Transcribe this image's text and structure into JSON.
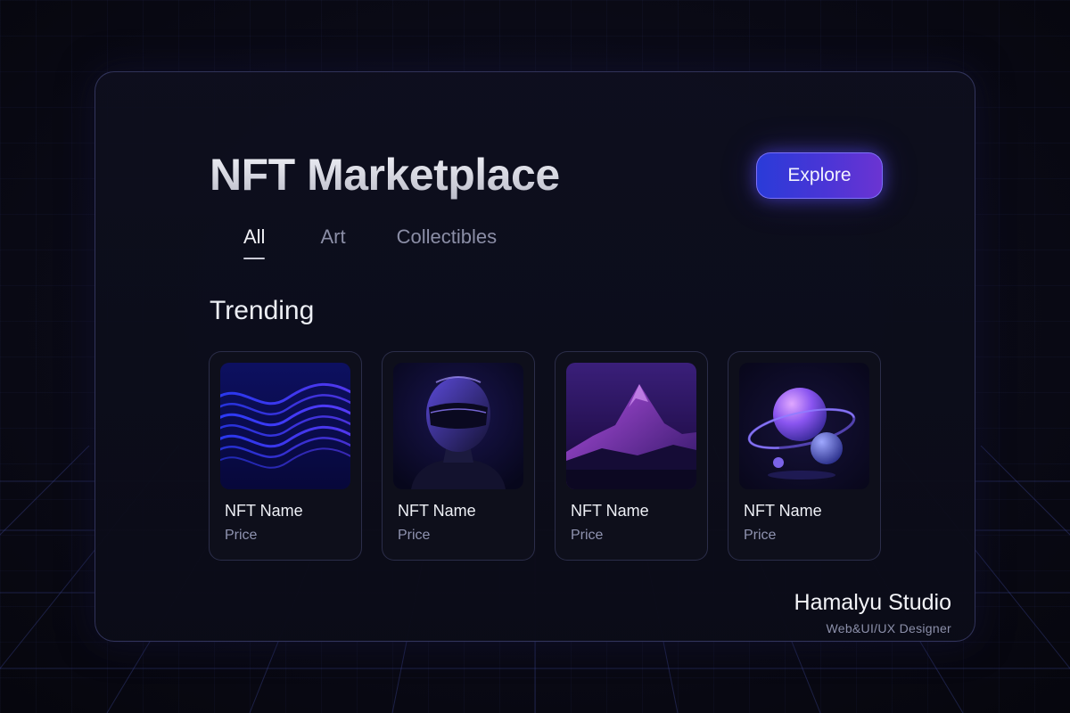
{
  "header": {
    "title": "NFT Marketplace",
    "explore_label": "Explore"
  },
  "tabs": [
    {
      "label": "All",
      "active": true
    },
    {
      "label": "Art",
      "active": false
    },
    {
      "label": "Collectibles",
      "active": false
    }
  ],
  "section": {
    "title": "Trending"
  },
  "cards": [
    {
      "name": "NFT Name",
      "price": "Price",
      "image": "blue-waves-image"
    },
    {
      "name": "NFT Name",
      "price": "Price",
      "image": "helmet-figure-image"
    },
    {
      "name": "NFT Name",
      "price": "Price",
      "image": "purple-mountain-image"
    },
    {
      "name": "NFT Name",
      "price": "Price",
      "image": "planet-spheres-image"
    }
  ],
  "footer": {
    "studio_name": "Hamalyu Studio",
    "studio_role": "Web&UI/UX Designer"
  },
  "colors": {
    "background": "#07070f",
    "panel_border": "#5f64aa",
    "accent_blue": "#2a3bd8",
    "accent_purple": "#6b34d2",
    "text_primary": "#eef0f6",
    "text_muted": "#8b8ea6"
  }
}
